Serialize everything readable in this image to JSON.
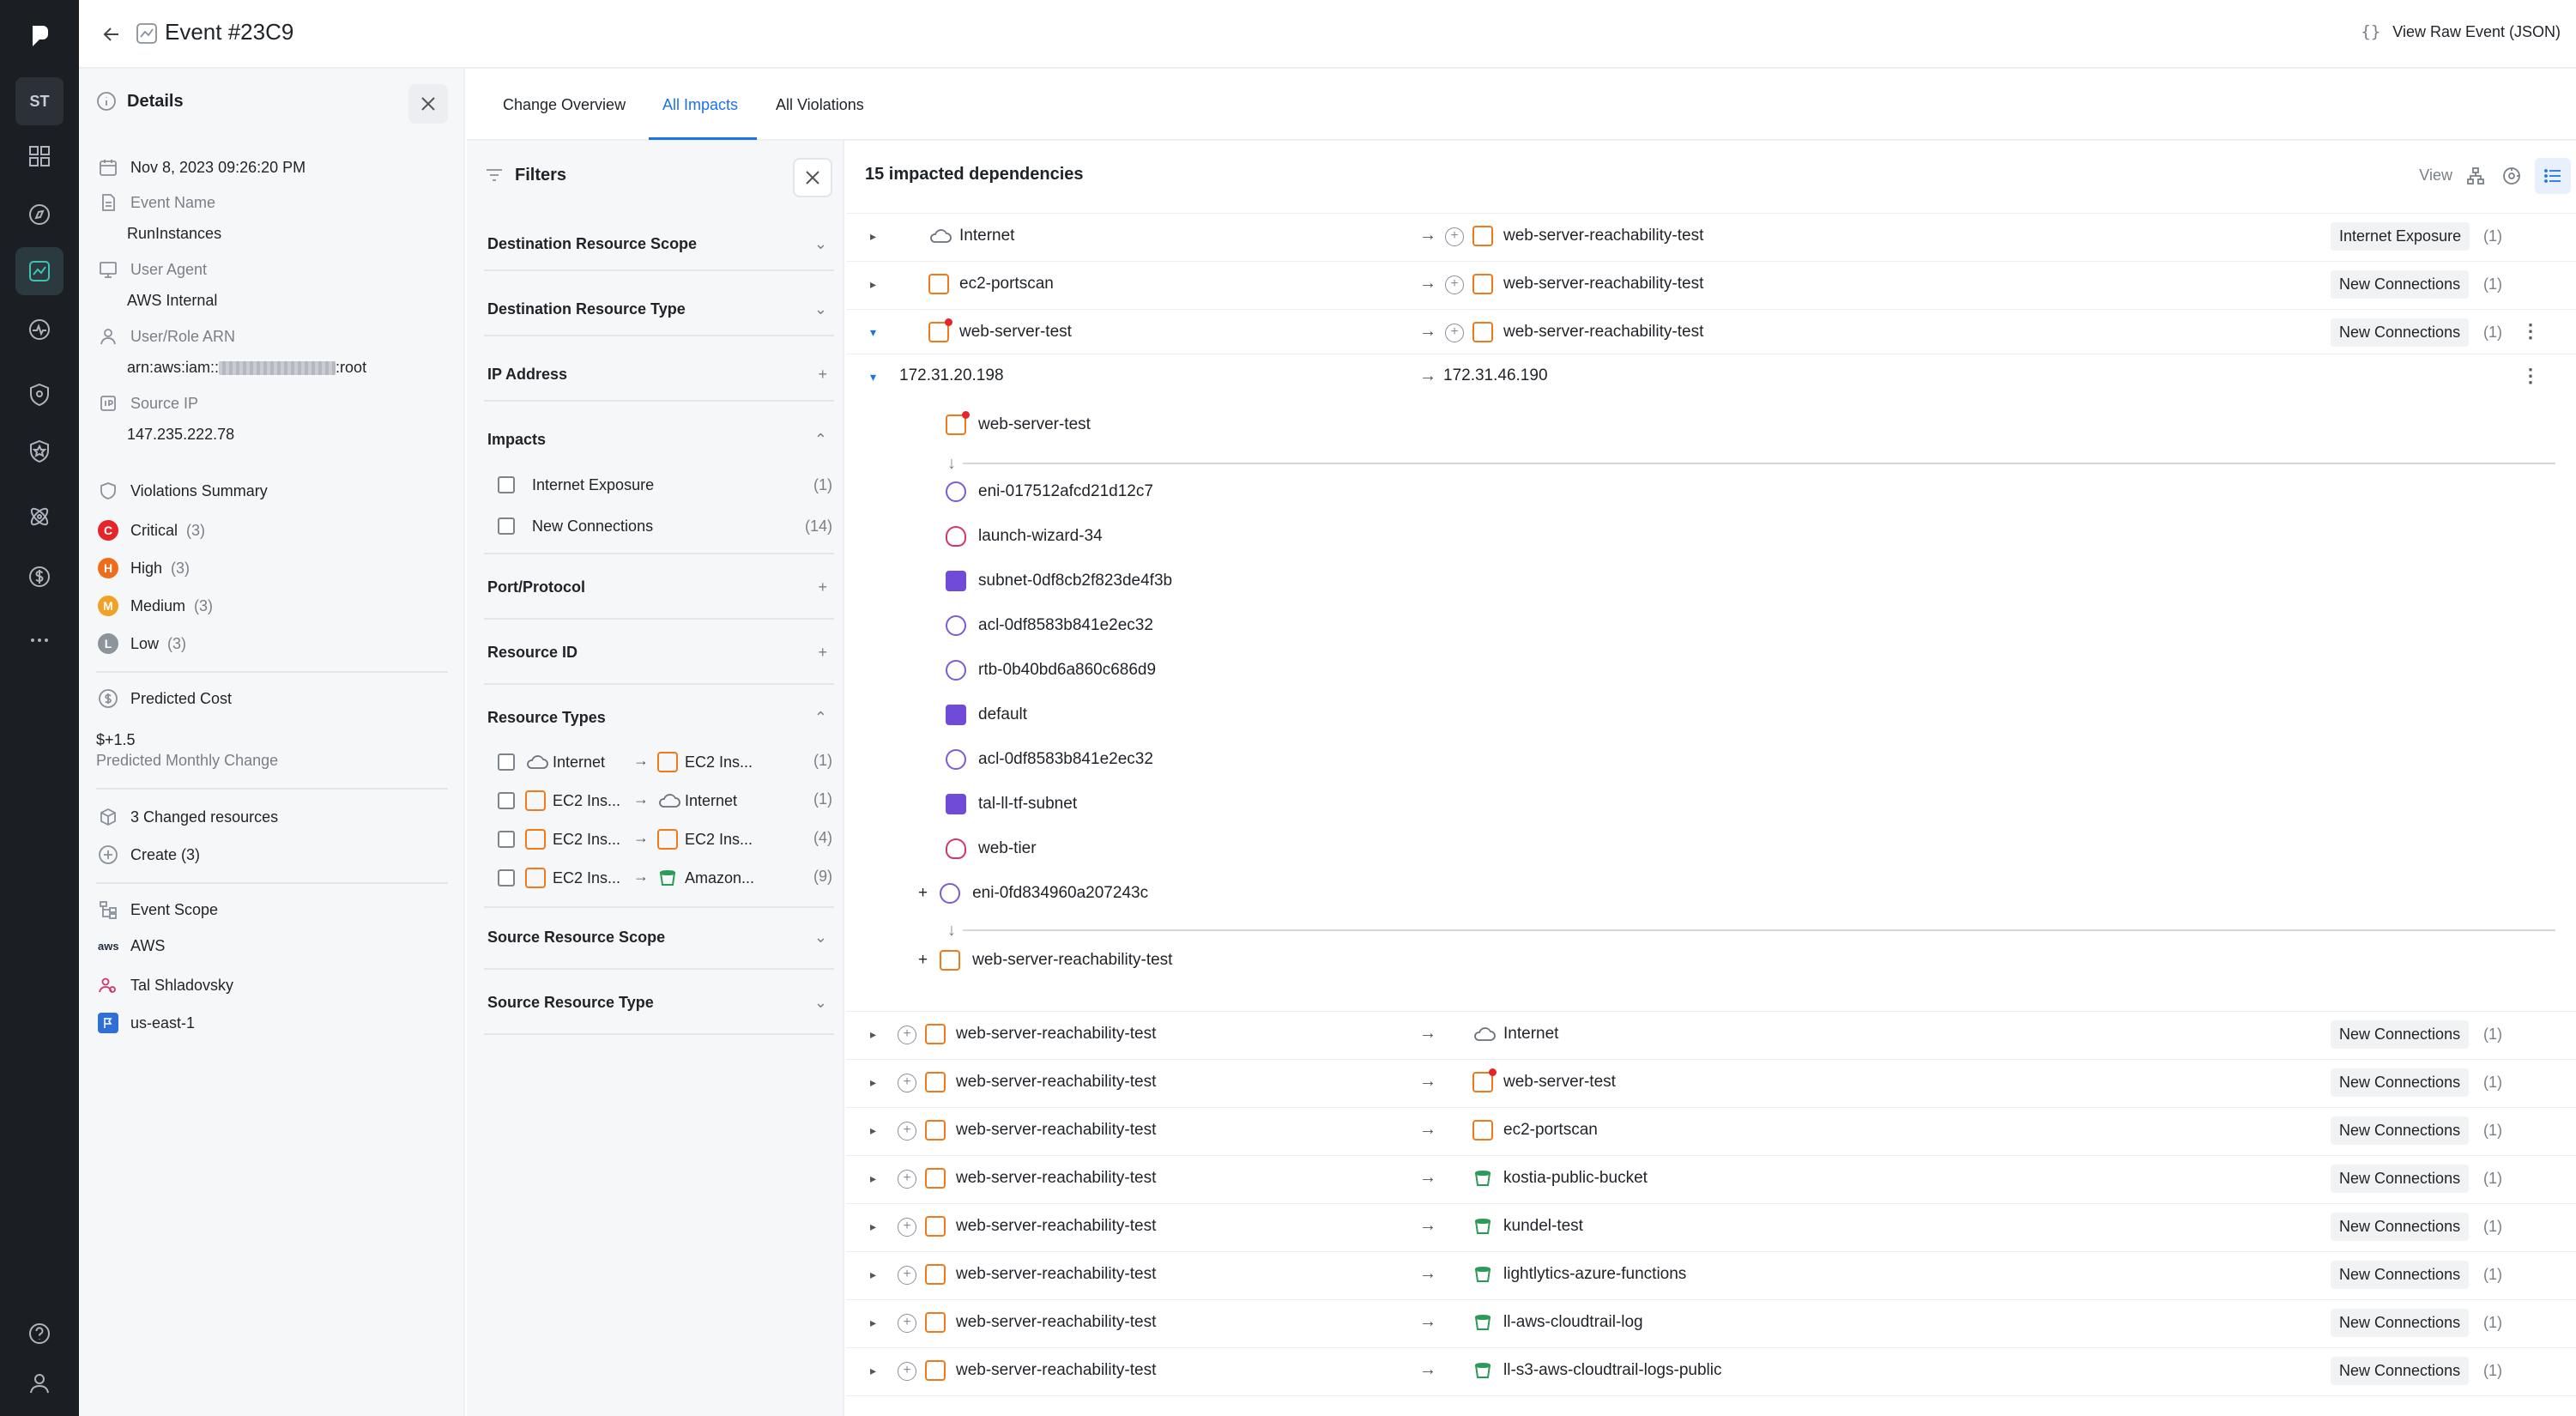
{
  "rail": {
    "avatar": "ST"
  },
  "topbar": {
    "title": "Event #23C9",
    "raw_braces": "{}",
    "raw_label": "View Raw Event (JSON)"
  },
  "details": {
    "header": "Details",
    "datetime": "Nov 8, 2023 09:26:20 PM",
    "event_name_label": "Event Name",
    "event_name": "RunInstances",
    "user_agent_label": "User Agent",
    "user_agent": "AWS Internal",
    "user_role_label": "User/Role ARN",
    "user_role_prefix": "arn:aws:iam::",
    "user_role_suffix": ":root",
    "source_ip_label": "Source IP",
    "source_ip": "147.235.222.78",
    "violations_label": "Violations Summary",
    "violations": [
      {
        "letter": "C",
        "name": "Critical",
        "count": "(3)",
        "color": "#e5252a"
      },
      {
        "letter": "H",
        "name": "High",
        "count": "(3)",
        "color": "#ef6c1a"
      },
      {
        "letter": "M",
        "name": "Medium",
        "count": "(3)",
        "color": "#f2a026"
      },
      {
        "letter": "L",
        "name": "Low",
        "count": "(3)",
        "color": "#8d949c"
      }
    ],
    "cost_label": "Predicted Cost",
    "cost_value": "$+1.5",
    "cost_sub": "Predicted Monthly Change",
    "changed_label": "3 Changed resources",
    "create_label": "Create (3)",
    "scope_label": "Event Scope",
    "scope_aws_logo": "aws",
    "scope_aws": "AWS",
    "scope_user": "Tal Shladovsky",
    "scope_region": "us-east-1"
  },
  "tabs": [
    "Change Overview",
    "All Impacts",
    "All Violations"
  ],
  "filters": {
    "title": "Filters",
    "sections": {
      "dest_scope": "Destination Resource Scope",
      "dest_type": "Destination Resource Type",
      "ip": "IP Address",
      "impacts": "Impacts",
      "port": "Port/Protocol",
      "resource_id": "Resource ID",
      "resource_types": "Resource Types",
      "src_scope": "Source Resource Scope",
      "src_type": "Source Resource Type"
    },
    "impacts": [
      {
        "label": "Internet Exposure",
        "count": "(1)"
      },
      {
        "label": "New Connections",
        "count": "(14)"
      }
    ],
    "resource_types": [
      {
        "from": "Internet",
        "to": "EC2 Ins...",
        "count": "(1)"
      },
      {
        "from": "EC2 Ins...",
        "to": "Internet",
        "count": "(1)"
      },
      {
        "from": "EC2 Ins...",
        "to": "EC2 Ins...",
        "count": "(4)"
      },
      {
        "from": "EC2 Ins...",
        "to": "Amazon...",
        "count": "(9)"
      }
    ]
  },
  "main": {
    "header": "15 impacted dependencies",
    "view_label": "View",
    "top_rows": [
      {
        "src": "Internet",
        "dst": "web-server-reachability-test",
        "badge": "Internet Exposure",
        "count": "(1)"
      },
      {
        "src": "ec2-portscan",
        "dst": "web-server-reachability-test",
        "badge": "New Connections",
        "count": "(1)"
      },
      {
        "src": "web-server-test",
        "dst": "web-server-reachability-test",
        "badge": "New Connections",
        "count": "(1)"
      }
    ],
    "ip_row": {
      "src": "172.31.20.198",
      "dst": "172.31.46.190"
    },
    "path_nodes": [
      "web-server-test",
      "eni-017512afcd21d12c7",
      "launch-wizard-34",
      "subnet-0df8cb2f823de4f3b",
      "acl-0df8583b841e2ec32",
      "rtb-0b40bd6a860c686d9",
      "default",
      "acl-0df8583b841e2ec32",
      "tal-ll-tf-subnet",
      "web-tier",
      "eni-0fd834960a207243c",
      "web-server-reachability-test"
    ],
    "bottom_rows": [
      {
        "src": "web-server-reachability-test",
        "dst": "Internet",
        "badge": "New Connections",
        "count": "(1)"
      },
      {
        "src": "web-server-reachability-test",
        "dst": "web-server-test",
        "badge": "New Connections",
        "count": "(1)"
      },
      {
        "src": "web-server-reachability-test",
        "dst": "ec2-portscan",
        "badge": "New Connections",
        "count": "(1)"
      },
      {
        "src": "web-server-reachability-test",
        "dst": "kostia-public-bucket",
        "badge": "New Connections",
        "count": "(1)"
      },
      {
        "src": "web-server-reachability-test",
        "dst": "kundel-test",
        "badge": "New Connections",
        "count": "(1)"
      },
      {
        "src": "web-server-reachability-test",
        "dst": "lightlytics-azure-functions",
        "badge": "New Connections",
        "count": "(1)"
      },
      {
        "src": "web-server-reachability-test",
        "dst": "ll-aws-cloudtrail-log",
        "badge": "New Connections",
        "count": "(1)"
      },
      {
        "src": "web-server-reachability-test",
        "dst": "ll-s3-aws-cloudtrail-logs-public",
        "badge": "New Connections",
        "count": "(1)"
      }
    ]
  },
  "colors": {
    "accent": "#1a73e8",
    "rail_bg": "#1b1f24",
    "rail_active": "#3ec2b3",
    "ec2": "#ef7a1a",
    "bucket": "#2c9b57"
  }
}
